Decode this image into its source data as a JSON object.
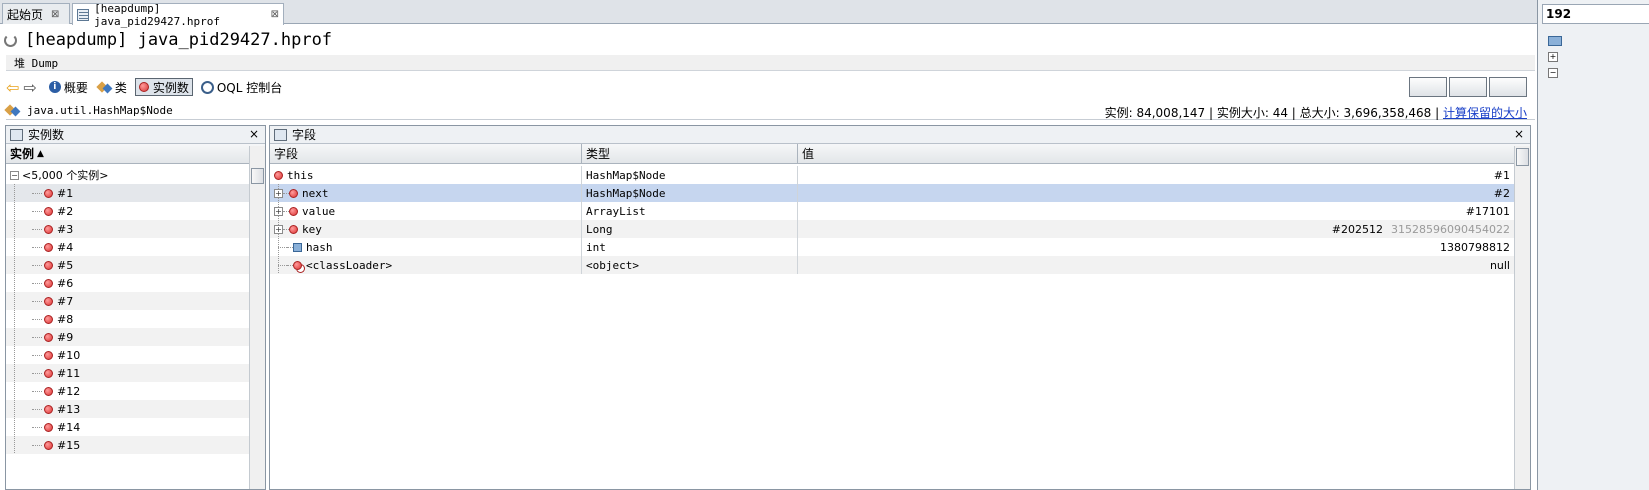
{
  "tabs": [
    {
      "label": "起始页",
      "close": "⊠"
    },
    {
      "label": "[heapdump] java_pid29427.hprof",
      "close": "⊠"
    }
  ],
  "title": "[heapdump] java_pid29427.hprof",
  "heap_label": "堆 Dump",
  "toolbar": {
    "summary": "概要",
    "classes": "类",
    "instances": "实例数",
    "oql": "OQL 控制台"
  },
  "class_bar": {
    "class_name": "java.util.HashMap$Node",
    "stats": "实例: 84,008,147 | 实例大小: 44 | 总大小: 3,696,358,468 |",
    "retained_link": "计算保留的大小"
  },
  "left_panel": {
    "title": "实例数",
    "close": "×",
    "column": "实例",
    "sort_indicator": "▲",
    "group": "<5,000 个实例>",
    "instances": [
      "#1",
      "#2",
      "#3",
      "#4",
      "#5",
      "#6",
      "#7",
      "#8",
      "#9",
      "#10",
      "#11",
      "#12",
      "#13",
      "#14",
      "#15"
    ]
  },
  "fields_panel": {
    "title": "字段",
    "close": "×",
    "columns": [
      "字段",
      "类型",
      "值"
    ],
    "rows": [
      {
        "field": "this",
        "type": "HashMap$Node",
        "value": "#1",
        "extra": ""
      },
      {
        "field": "next",
        "type": "HashMap$Node",
        "value": "#2",
        "extra": ""
      },
      {
        "field": "value",
        "type": "ArrayList",
        "value": "#17101",
        "extra": ""
      },
      {
        "field": "key",
        "type": "Long",
        "value": "#202512",
        "extra": "3152859609045402​2"
      },
      {
        "field": "hash",
        "type": "int",
        "value": "1380798812",
        "extra": ""
      },
      {
        "field": "<classLoader>",
        "type": "<object>",
        "value": "null",
        "extra": ""
      }
    ]
  },
  "right_strip": {
    "tab_label": "192"
  }
}
